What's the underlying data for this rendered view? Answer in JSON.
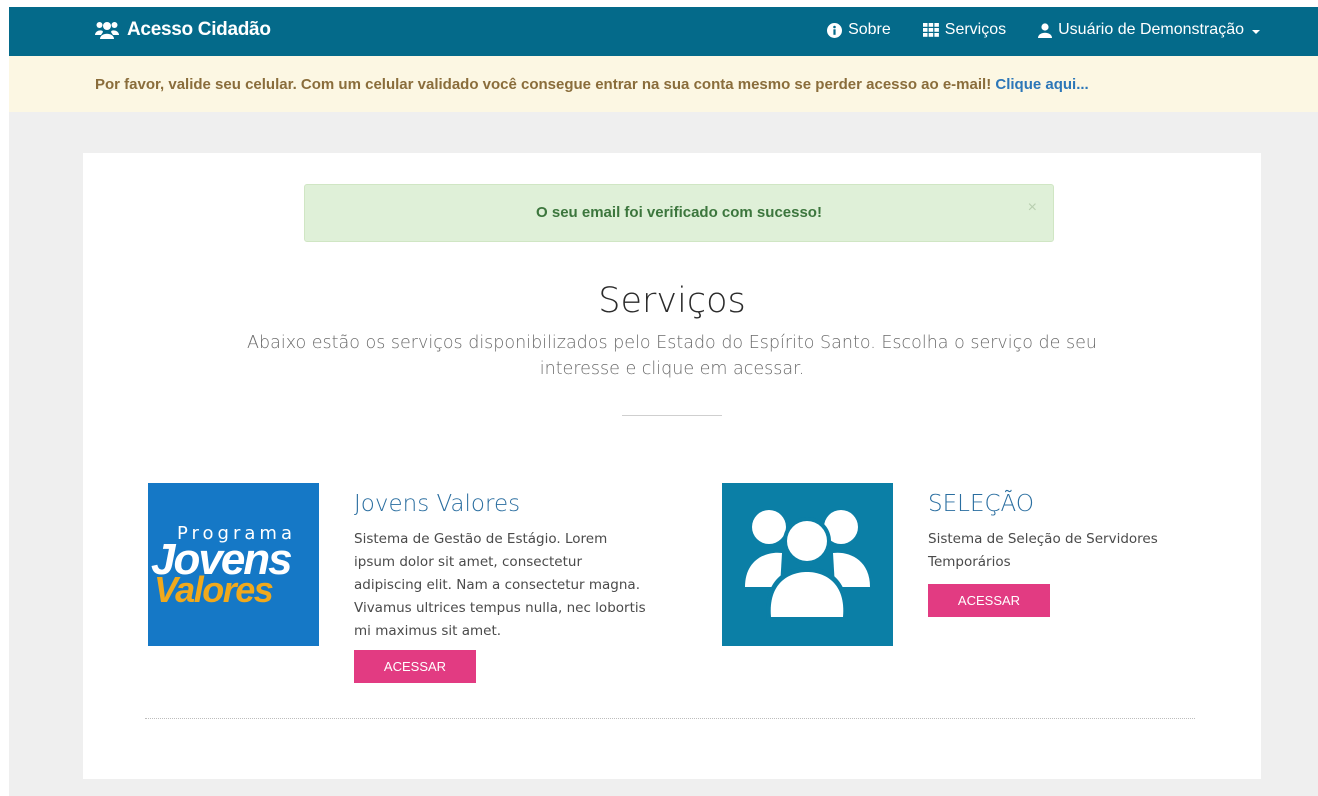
{
  "navbar": {
    "brand": "Acesso Cidadão",
    "links": {
      "about": "Sobre",
      "services": "Serviços",
      "user": "Usuário de Demonstração"
    }
  },
  "warning": {
    "text": "Por favor, valide seu celular. Com um celular validado você consegue entrar na sua conta mesmo se perder acesso ao e-mail!",
    "link": "Clique aqui..."
  },
  "alert": {
    "message": "O seu email foi verificado com sucesso!",
    "close": "×"
  },
  "page": {
    "title": "Serviços",
    "subtitle": "Abaixo estão os serviços disponibilizados pelo Estado do Espírito Santo. Escolha o serviço de seu interesse e clique em acessar."
  },
  "services": [
    {
      "logo_text": {
        "line1": "Programa",
        "line2": "Jovens",
        "line3": "Valores"
      },
      "title": "Jovens Valores",
      "description": "Sistema de Gestão de Estágio. Lorem ipsum dolor sit amet, consectetur adipiscing elit. Nam a consectetur magna. Vivamus ultrices tempus nulla, nec lobortis mi maximus sit amet.",
      "button": "ACESSAR"
    },
    {
      "icon": "users-icon",
      "title": "SELEÇÃO",
      "description": "Sistema de Seleção de Servidores Temporários",
      "button": "ACESSAR"
    }
  ],
  "colors": {
    "navbar": "#046a8a",
    "warning_bg": "#fcf7e3",
    "alert_bg": "#dff0d8",
    "button": "#e23b82",
    "jovens_bg": "#1578c6",
    "selecao_bg": "#0b7fa6"
  }
}
